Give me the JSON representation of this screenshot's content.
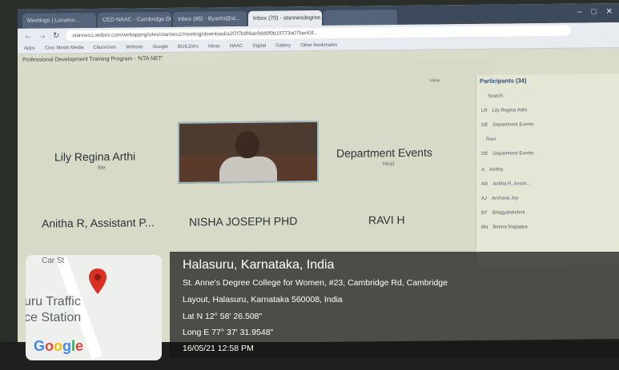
{
  "browser": {
    "tabs": [
      {
        "label": "Meetings | Lunamo...",
        "active": false
      },
      {
        "label": "CED-NAAC - Cambridge Digit...",
        "active": false
      },
      {
        "label": "Inbox (86) - lilyarthi@st...",
        "active": false
      },
      {
        "label": "Inbox (70) - stannesdegree...",
        "active": true
      },
      {
        "label": "",
        "active": false
      }
    ],
    "url": "stannes1.webex.com/webappng/sites/stannes1/meeting/download/a2f7f7b9f4ae9dd0f9b19773a07fae43f...",
    "bookmarks": [
      "Apps",
      "Civic Minds Media",
      "Classroom",
      "Website",
      "Google",
      "BUILDers",
      "Ideas",
      "NAAC",
      "Digital",
      "Gallery",
      "Other bookmarks"
    ]
  },
  "meeting": {
    "title": "Professional Development Training Program - 'NTA NET'",
    "view_label": "View",
    "tiles": [
      {
        "name": "Lily Regina Arthi",
        "sub": "Me"
      },
      {
        "name": "Department Events",
        "sub": "Host"
      },
      {
        "name": "Anitha R, Assistant P...",
        "sub": ""
      },
      {
        "name": "NISHA JOSEPH PHD",
        "sub": ""
      },
      {
        "name": "RAVI H",
        "sub": ""
      }
    ]
  },
  "participants": {
    "title": "Participants (34)",
    "search": "Search",
    "items": [
      {
        "initials": "LR",
        "name": "Lily Regina Arthi"
      },
      {
        "initials": "DE",
        "name": "Department Events"
      },
      {
        "initials": "",
        "name": "Ravi"
      },
      {
        "initials": "DE",
        "name": "Department Events"
      },
      {
        "initials": "A",
        "name": "Anitha"
      },
      {
        "initials": "AR",
        "name": "Anitha R, Assist..."
      },
      {
        "initials": "AJ",
        "name": "Archana Joy"
      },
      {
        "initials": "BT",
        "name": "Bhagyalakshmi"
      },
      {
        "initials": "BN",
        "name": "Beena Nagappa"
      }
    ]
  },
  "geotag": {
    "location": "Halasuru, Karnataka, India",
    "address_line1": "St. Anne's Degree College for Women, #23, Cambridge Rd, Cambridge",
    "address_line2": "Layout, Halasuru, Karnataka 560008, India",
    "lat": "Lat N 12° 58' 26.508\"",
    "lng": "Long E 77° 37' 31.9548\"",
    "datetime": "16/05/21 12:58 PM"
  },
  "map": {
    "label_top": "Car St",
    "label_mid1": "uru Traffic",
    "label_mid2": "ce Station",
    "brand": "Google",
    "pin_color": "#d93025"
  }
}
